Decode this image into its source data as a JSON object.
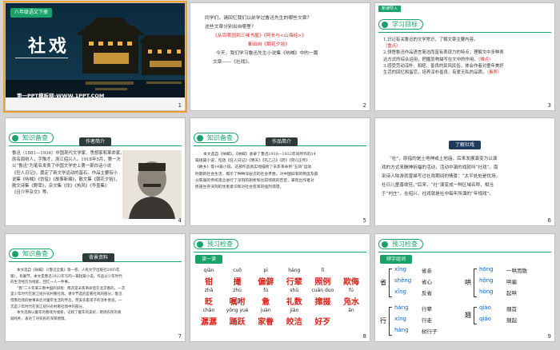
{
  "slides": {
    "s1": {
      "number": "1",
      "badge": "八年级语文下册",
      "title": "社戏",
      "footer": "第一PPT模板网-WWW.1PPT.COM"
    },
    "s2": {
      "number": "2",
      "l1": "同学们，请回忆我们以前学过鲁迅先生的哪些文章？",
      "l2": "这些文章分别出自哪里？",
      "l3": "《从百草园到三味书屋》《阿长与<山海经>》",
      "l4": "都出自《朝花夕拾》",
      "l5": "今天，我们学习鲁迅先生小说集《呐喊》中的一篇",
      "l6": "文章——《社戏》。"
    },
    "s3": {
      "number": "3",
      "section": "学习目标",
      "tag": "新课导入",
      "g1": "1.识记有关鲁迅的文学常识，了解文章主要内容。",
      "g1b": "（重点）",
      "g2": "2.领悟鲁迅作品语言简洁而富有表现力的特点；理解文中多种表",
      "g2b": "达方式的综合运用，把握景物描写在文中的作用。",
      "g2c": "（难点）",
      "g3": "3.感受劳动淳朴、和睦、善良的民风民俗，体会作者对童年美好",
      "g3b": "生活的回忆和留恋，培养淳朴善良、有爱无私的品质。",
      "g3c": "（素养）"
    },
    "s4": {
      "number": "4",
      "section": "知识备查",
      "band": "作者简介",
      "p1": "鲁迅（1881—1936）中国现代文学家、思想家和革命家。",
      "p2": "原名周树人，字豫才，浙江绍兴人。1918年5月，第一次",
      "p3": "以“鲁迅”为笔名发表了中国文学史上第一部白话小说",
      "p4": "《狂人日记》，奠定了新文学运动的基石。作品主要有小",
      "p5": "说集《呐喊》《彷徨》《故事新编》，散文集《朝花夕拾》，",
      "p6": "散文诗集《野草》，杂文集《坟》《热风》《华盖集》",
      "p7": "《且介亭杂文》等。"
    },
    "s5": {
      "number": "5",
      "section": "知识备查",
      "band": "作品简介",
      "p1": "本文选自《呐喊》。《呐喊》收录了鲁迅1918—1922年间所作的14",
      "p2": "篇短篇小说，包括《狂人日记》《明天》《孔乙己》《药》《阿Q正传》",
      "p3": "《故乡》等14篇小说。这部作品真实地描绘了辛亥革命到“五四”运动",
      "p4": "时期的社会生活，揭示了种种深层次的社会矛盾，对中国旧有的制度及部",
      "p5": "分陈腐的传统观念进行了深刻的剖析和比较彻底的否定，表现出作者对",
      "p6": "民族生存深刻的忧患意识和对社会变革的强烈渴望。"
    },
    "s6": {
      "number": "6",
      "band": "了解社戏",
      "p1": "“社”，原指的是土地神或土地庙。后来发展演变为以演",
      "p2": "戏的方式来酬神祈福的活动，活动中演的戏就叫“社戏”。南",
      "p3": "宋诗人陆游就曾描写过社戏期间的情景：“太平处处是优场，",
      "p4": "社日儿童喜欲狂。”后来，“社”演变成一种区域名称，相当",
      "p5": "于“村庄”。在绍兴，社戏就是社中每年所演的“年规戏”。"
    },
    "s7": {
      "number": "7",
      "section": "知识备查",
      "band": "背景资料",
      "p1": "本文选自《呐喊》（《鲁迅全集》第一卷，人民文学出版社2005年",
      "p2": "版），有删节。本文是鲁迅1922年写的一篇短篇小说。作品以少年时代",
      "p3": "的生活经历为线索，回忆一人一件事。",
      "p4": "“我”二十年来三看中国的旧戏：两次是辛亥革命后在北京看的，一次",
      "p5": "是少年时代在浙江绍兴农村看社戏。课文节选的是看社戏的部分。鲁迅",
      "p6": "借看社戏的故事表达对童年生活的怀念，赞美农家孩子的淳朴善良。一",
      "p7": "次是少年时代在浙江绍兴农村看社戏中的部分。",
      "p8": "本文选择以童年的看戏为线索，记叙了童年的美好，歌颂农民的真",
      "p9": "诚纯朴，表达了对农民的深厚感情。"
    },
    "s8": {
      "number": "8",
      "section": "预习检查",
      "band": "读一读",
      "py1": [
        "qiān",
        "cuō",
        "pì",
        "háng",
        "lǐ",
        ""
      ],
      "ch1": [
        "钳",
        "撮",
        "偏僻",
        "行辈",
        "照例",
        "欺侮"
      ],
      "py2": [
        "zhǎ",
        "zhù",
        "fú",
        "shū",
        "cuān duo",
        "fú"
      ],
      "ch2": [
        "眨",
        "嘱咐",
        "惫",
        "礼数",
        "撺掇",
        "凫水"
      ],
      "py3": [
        "chǎn",
        "yǒng yuè",
        "juàn",
        "jiāo",
        "",
        "ǎn"
      ],
      "ch3": [
        "潺潺",
        "踊跃",
        "家眷",
        "皎洁",
        "好歹",
        ""
      ]
    },
    "s9": {
      "number": "9",
      "section": "预习检查",
      "band": "辨字组词",
      "g1char": "省",
      "g1": [
        [
          "xǐng",
          "省亲"
        ],
        [
          "shěng",
          "省心"
        ],
        [
          "xǐng",
          "反省"
        ]
      ],
      "g2char": "哄",
      "g2": [
        [
          "hōng",
          "一哄而散"
        ],
        [
          "hǒng",
          "哄骗"
        ],
        [
          "hòng",
          "起哄"
        ]
      ],
      "g3char": "行",
      "g3": [
        [
          "háng",
          "行辈"
        ],
        [
          "xíng",
          "行走"
        ],
        [
          "háng",
          "树行子"
        ]
      ],
      "g4char": "翘",
      "g4": [
        [
          "qiào",
          "翘首"
        ],
        [
          "qiáo",
          "翘起"
        ]
      ]
    }
  },
  "colors": {
    "accent": "#19a36a",
    "red": "#d9241c",
    "selection": "#f0a030"
  }
}
